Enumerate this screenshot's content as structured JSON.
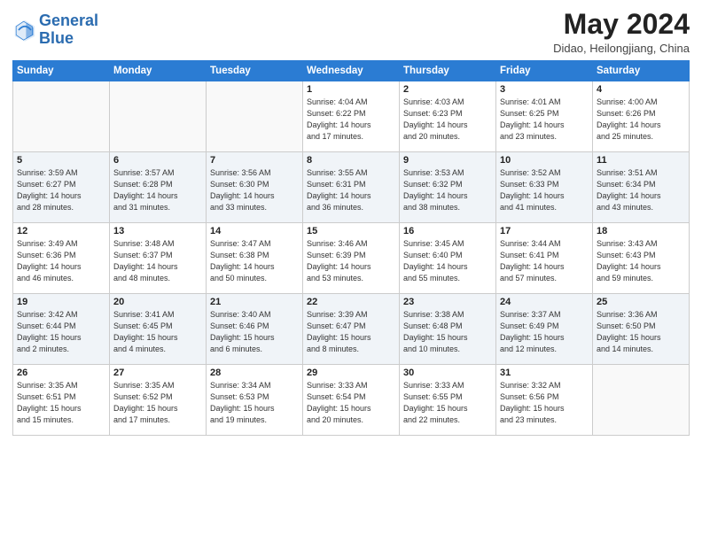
{
  "header": {
    "logo_line1": "General",
    "logo_line2": "Blue",
    "title": "May 2024",
    "location": "Didao, Heilongjiang, China"
  },
  "days_of_week": [
    "Sunday",
    "Monday",
    "Tuesday",
    "Wednesday",
    "Thursday",
    "Friday",
    "Saturday"
  ],
  "weeks": [
    [
      {
        "day": "",
        "info": ""
      },
      {
        "day": "",
        "info": ""
      },
      {
        "day": "",
        "info": ""
      },
      {
        "day": "1",
        "info": "Sunrise: 4:04 AM\nSunset: 6:22 PM\nDaylight: 14 hours\nand 17 minutes."
      },
      {
        "day": "2",
        "info": "Sunrise: 4:03 AM\nSunset: 6:23 PM\nDaylight: 14 hours\nand 20 minutes."
      },
      {
        "day": "3",
        "info": "Sunrise: 4:01 AM\nSunset: 6:25 PM\nDaylight: 14 hours\nand 23 minutes."
      },
      {
        "day": "4",
        "info": "Sunrise: 4:00 AM\nSunset: 6:26 PM\nDaylight: 14 hours\nand 25 minutes."
      }
    ],
    [
      {
        "day": "5",
        "info": "Sunrise: 3:59 AM\nSunset: 6:27 PM\nDaylight: 14 hours\nand 28 minutes."
      },
      {
        "day": "6",
        "info": "Sunrise: 3:57 AM\nSunset: 6:28 PM\nDaylight: 14 hours\nand 31 minutes."
      },
      {
        "day": "7",
        "info": "Sunrise: 3:56 AM\nSunset: 6:30 PM\nDaylight: 14 hours\nand 33 minutes."
      },
      {
        "day": "8",
        "info": "Sunrise: 3:55 AM\nSunset: 6:31 PM\nDaylight: 14 hours\nand 36 minutes."
      },
      {
        "day": "9",
        "info": "Sunrise: 3:53 AM\nSunset: 6:32 PM\nDaylight: 14 hours\nand 38 minutes."
      },
      {
        "day": "10",
        "info": "Sunrise: 3:52 AM\nSunset: 6:33 PM\nDaylight: 14 hours\nand 41 minutes."
      },
      {
        "day": "11",
        "info": "Sunrise: 3:51 AM\nSunset: 6:34 PM\nDaylight: 14 hours\nand 43 minutes."
      }
    ],
    [
      {
        "day": "12",
        "info": "Sunrise: 3:49 AM\nSunset: 6:36 PM\nDaylight: 14 hours\nand 46 minutes."
      },
      {
        "day": "13",
        "info": "Sunrise: 3:48 AM\nSunset: 6:37 PM\nDaylight: 14 hours\nand 48 minutes."
      },
      {
        "day": "14",
        "info": "Sunrise: 3:47 AM\nSunset: 6:38 PM\nDaylight: 14 hours\nand 50 minutes."
      },
      {
        "day": "15",
        "info": "Sunrise: 3:46 AM\nSunset: 6:39 PM\nDaylight: 14 hours\nand 53 minutes."
      },
      {
        "day": "16",
        "info": "Sunrise: 3:45 AM\nSunset: 6:40 PM\nDaylight: 14 hours\nand 55 minutes."
      },
      {
        "day": "17",
        "info": "Sunrise: 3:44 AM\nSunset: 6:41 PM\nDaylight: 14 hours\nand 57 minutes."
      },
      {
        "day": "18",
        "info": "Sunrise: 3:43 AM\nSunset: 6:43 PM\nDaylight: 14 hours\nand 59 minutes."
      }
    ],
    [
      {
        "day": "19",
        "info": "Sunrise: 3:42 AM\nSunset: 6:44 PM\nDaylight: 15 hours\nand 2 minutes."
      },
      {
        "day": "20",
        "info": "Sunrise: 3:41 AM\nSunset: 6:45 PM\nDaylight: 15 hours\nand 4 minutes."
      },
      {
        "day": "21",
        "info": "Sunrise: 3:40 AM\nSunset: 6:46 PM\nDaylight: 15 hours\nand 6 minutes."
      },
      {
        "day": "22",
        "info": "Sunrise: 3:39 AM\nSunset: 6:47 PM\nDaylight: 15 hours\nand 8 minutes."
      },
      {
        "day": "23",
        "info": "Sunrise: 3:38 AM\nSunset: 6:48 PM\nDaylight: 15 hours\nand 10 minutes."
      },
      {
        "day": "24",
        "info": "Sunrise: 3:37 AM\nSunset: 6:49 PM\nDaylight: 15 hours\nand 12 minutes."
      },
      {
        "day": "25",
        "info": "Sunrise: 3:36 AM\nSunset: 6:50 PM\nDaylight: 15 hours\nand 14 minutes."
      }
    ],
    [
      {
        "day": "26",
        "info": "Sunrise: 3:35 AM\nSunset: 6:51 PM\nDaylight: 15 hours\nand 15 minutes."
      },
      {
        "day": "27",
        "info": "Sunrise: 3:35 AM\nSunset: 6:52 PM\nDaylight: 15 hours\nand 17 minutes."
      },
      {
        "day": "28",
        "info": "Sunrise: 3:34 AM\nSunset: 6:53 PM\nDaylight: 15 hours\nand 19 minutes."
      },
      {
        "day": "29",
        "info": "Sunrise: 3:33 AM\nSunset: 6:54 PM\nDaylight: 15 hours\nand 20 minutes."
      },
      {
        "day": "30",
        "info": "Sunrise: 3:33 AM\nSunset: 6:55 PM\nDaylight: 15 hours\nand 22 minutes."
      },
      {
        "day": "31",
        "info": "Sunrise: 3:32 AM\nSunset: 6:56 PM\nDaylight: 15 hours\nand 23 minutes."
      },
      {
        "day": "",
        "info": ""
      }
    ]
  ]
}
